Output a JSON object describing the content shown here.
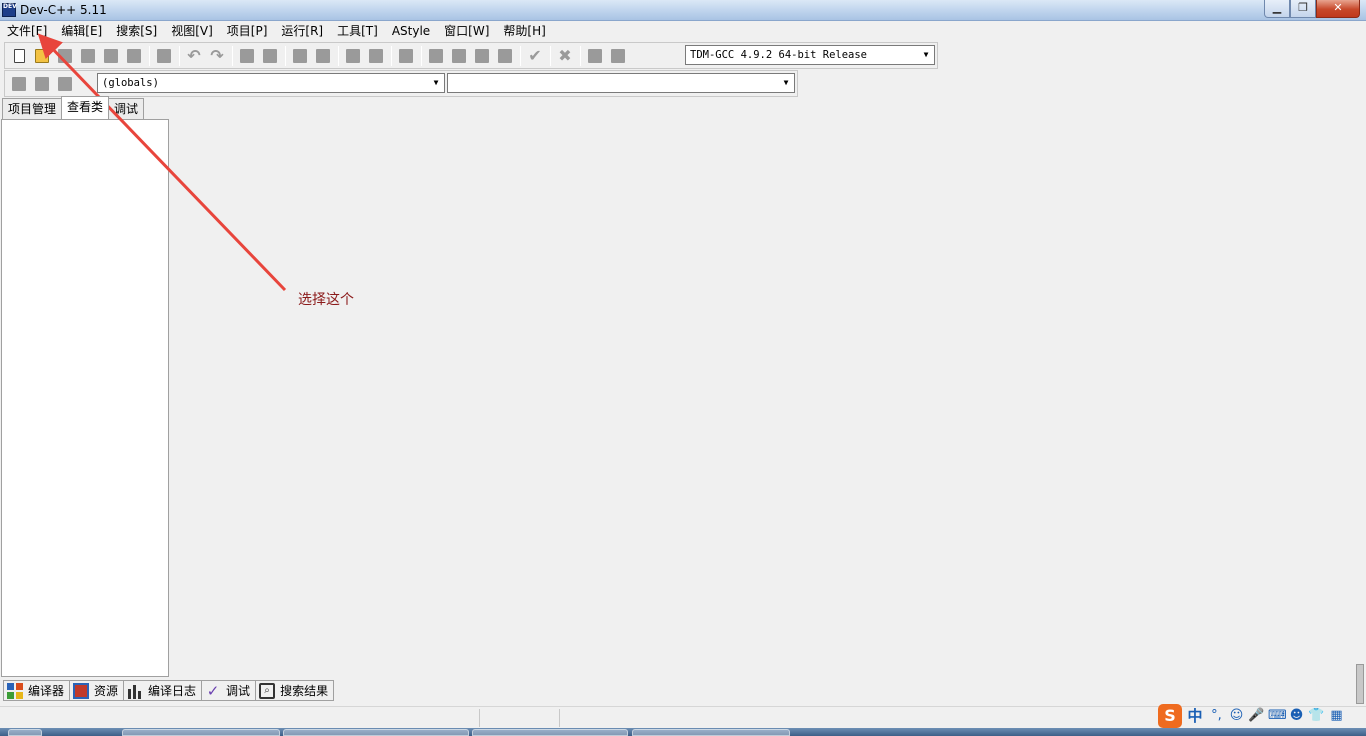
{
  "window": {
    "title": "Dev-C++ 5.11",
    "icon_label": "DEV"
  },
  "menu": [
    "文件[F]",
    "编辑[E]",
    "搜索[S]",
    "视图[V]",
    "项目[P]",
    "运行[R]",
    "工具[T]",
    "AStyle",
    "窗口[W]",
    "帮助[H]"
  ],
  "toolbar": {
    "compiler": "TDM-GCC 4.9.2 64-bit Release",
    "globals": "(globals)",
    "members": ""
  },
  "left_tabs": [
    "项目管理",
    "查看类",
    "调试"
  ],
  "bottom_tabs": [
    "编译器",
    "资源",
    "编译日志",
    "调试",
    "搜索结果"
  ],
  "annotation": {
    "text": "选择这个",
    "color": "#e8453c"
  },
  "ime": {
    "logo": "S",
    "lang": "中",
    "punct": "°,"
  }
}
